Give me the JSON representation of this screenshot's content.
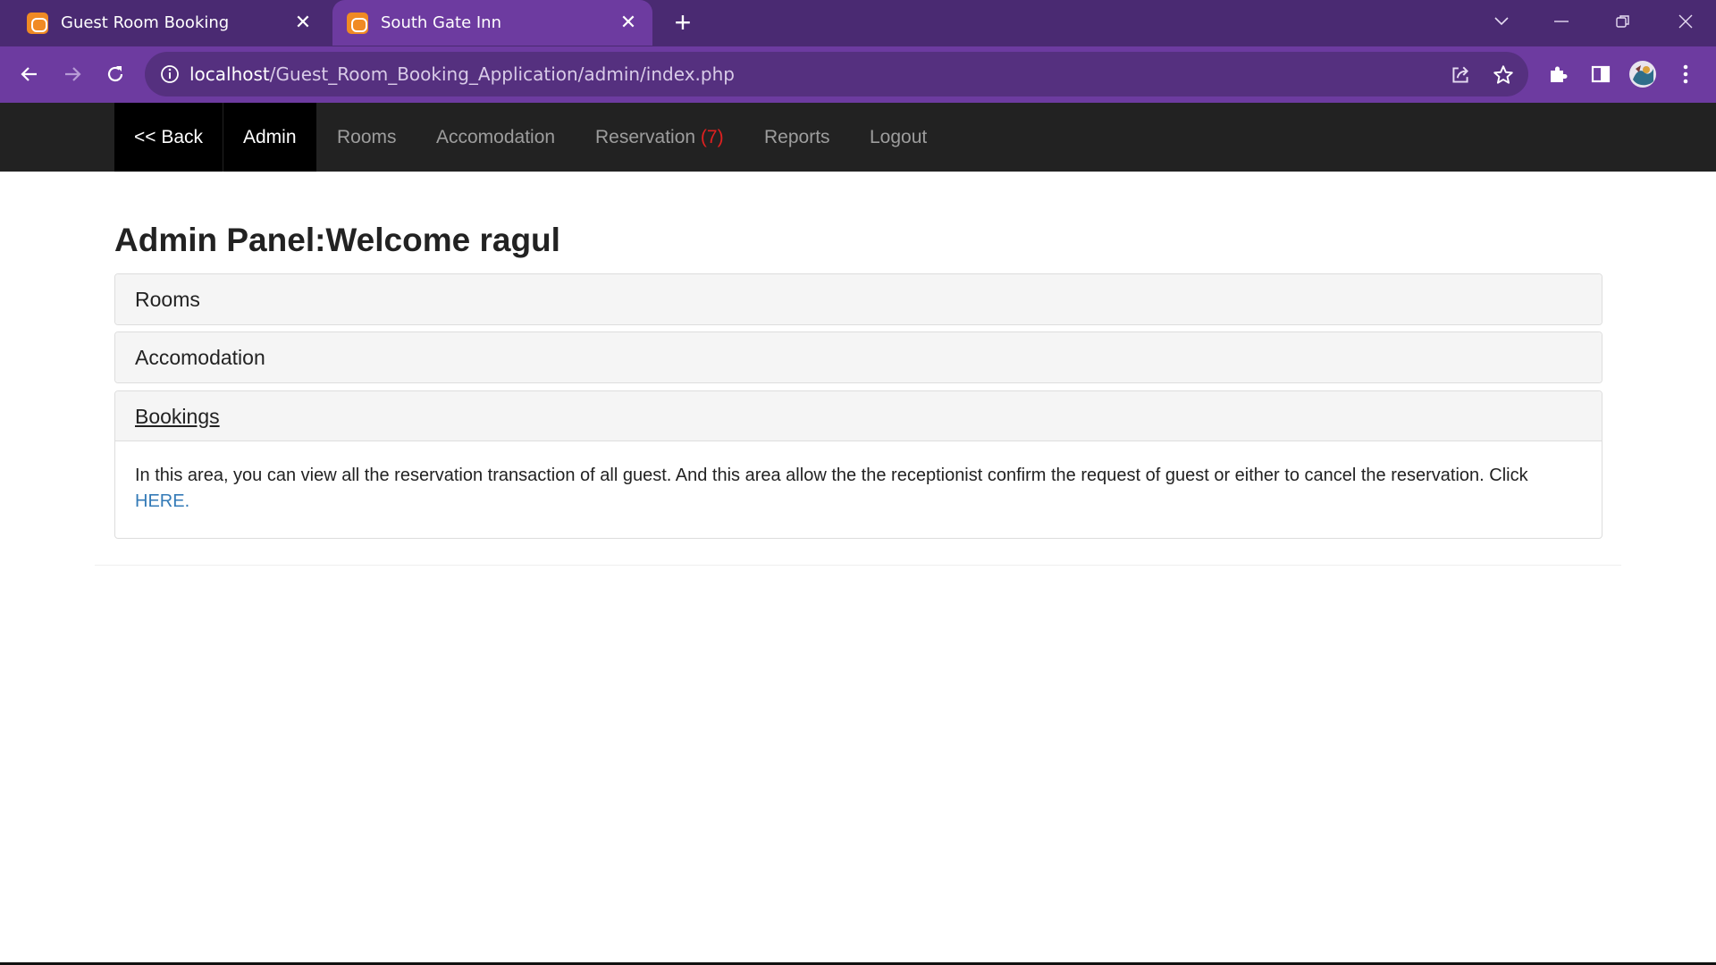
{
  "browser": {
    "tabs": [
      {
        "title": "Guest Room Booking",
        "active": false
      },
      {
        "title": "South Gate Inn",
        "active": true
      }
    ],
    "url_host": "localhost",
    "url_path": "/Guest_Room_Booking_Application/admin/index.php"
  },
  "navbar": {
    "back_label": "<< Back",
    "brand_label": "Admin",
    "items": [
      "Rooms",
      "Accomodation",
      "Reservation",
      "Reports",
      "Logout"
    ],
    "reservation_badge": "(7)"
  },
  "page": {
    "title": "Admin Panel:Welcome ragul",
    "panels": [
      {
        "heading": "Rooms"
      },
      {
        "heading": "Accomodation"
      },
      {
        "heading": "Bookings"
      }
    ],
    "bookings_text": "In this area, you can view all the reservation transaction of all guest. And this area allow the the receptionist confirm the request of guest or either to cancel the reservation. Click",
    "bookings_link": "HERE."
  },
  "colors": {
    "tabstrip": "#4a2a72",
    "toolbar": "#6d3ba0",
    "navbar": "#222222",
    "badge": "#e02020",
    "link": "#337ab7"
  }
}
